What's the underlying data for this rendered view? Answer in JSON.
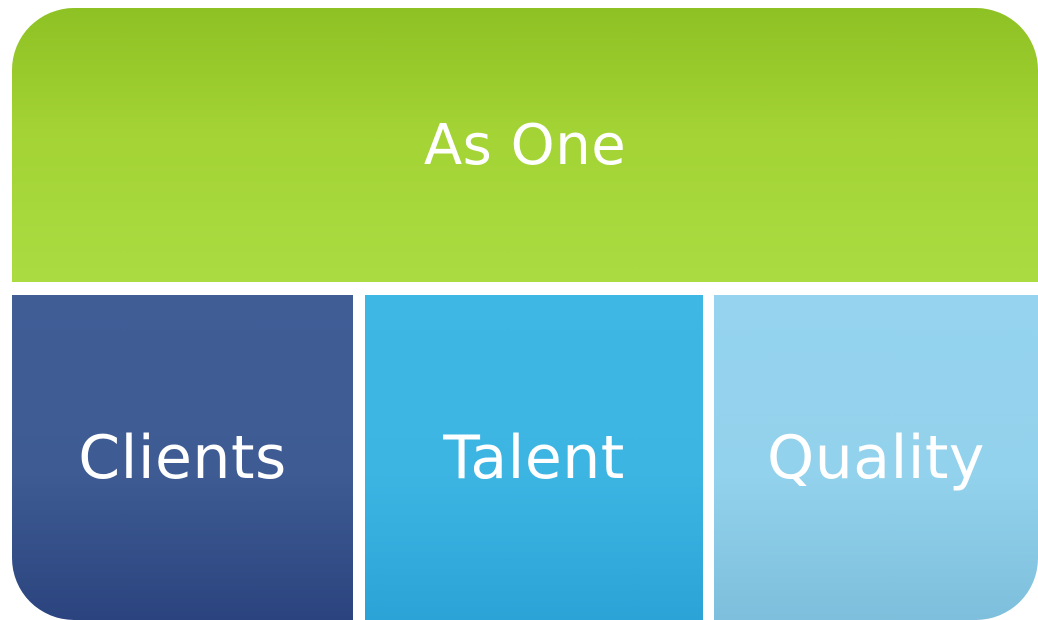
{
  "diagram": {
    "top": {
      "label": "As One",
      "color": "#a3d334"
    },
    "bottom": [
      {
        "label": "Clients",
        "color": "#3e5b93"
      },
      {
        "label": "Talent",
        "color": "#3db5e3"
      },
      {
        "label": "Quality",
        "color": "#93d2ec"
      }
    ]
  }
}
